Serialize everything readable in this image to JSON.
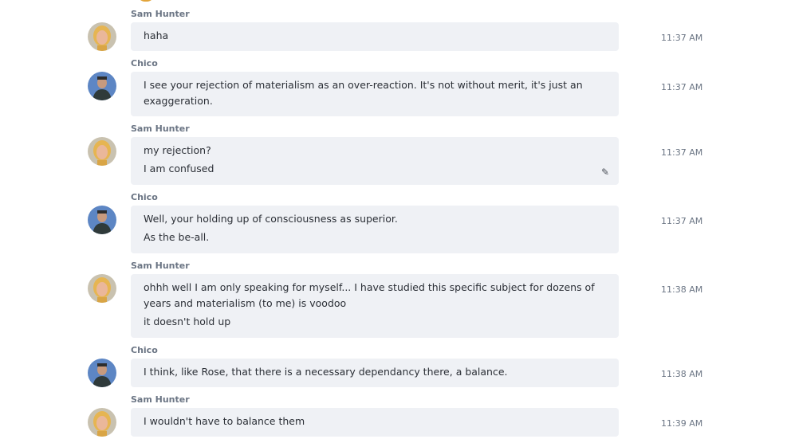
{
  "messages": [
    {
      "sender": "Sam Hunter",
      "avatar": "sam-avatar",
      "lines": [
        "haha"
      ],
      "time": "11:37 AM"
    },
    {
      "sender": "Chico",
      "avatar": "chico-avatar",
      "lines": [
        "I see your rejection of materialism as an over-reaction.  It's not without merit, it's just an exaggeration."
      ],
      "time": "11:37 AM"
    },
    {
      "sender": "Sam Hunter",
      "avatar": "sam-avatar",
      "lines": [
        "my rejection?",
        "I am confused"
      ],
      "time": "11:37 AM",
      "edit_icon": "typing-pencil-icon"
    },
    {
      "sender": "Chico",
      "avatar": "chico-avatar",
      "lines": [
        "Well, your holding up of consciousness as superior.",
        "As the be-all."
      ],
      "time": "11:37 AM"
    },
    {
      "sender": "Sam Hunter",
      "avatar": "sam-avatar",
      "lines": [
        "ohhh well I am only speaking for myself... I have studied this specific subject for dozens of years and materialism (to me) is voodoo",
        "it doesn't hold up"
      ],
      "time": "11:38 AM"
    },
    {
      "sender": "Chico",
      "avatar": "chico-avatar",
      "lines": [
        "I think, like Rose, that there is a necessary dependancy there, a balance."
      ],
      "time": "11:38 AM"
    },
    {
      "sender": "Sam Hunter",
      "avatar": "sam-avatar",
      "lines": [
        "I wouldn't have to balance them"
      ],
      "time": "11:39 AM"
    }
  ],
  "colors": {
    "bubble_bg": "#eff1f5",
    "sender_text": "#6b7584",
    "message_text": "#2b2f36",
    "timestamp_text": "#6b7584"
  }
}
